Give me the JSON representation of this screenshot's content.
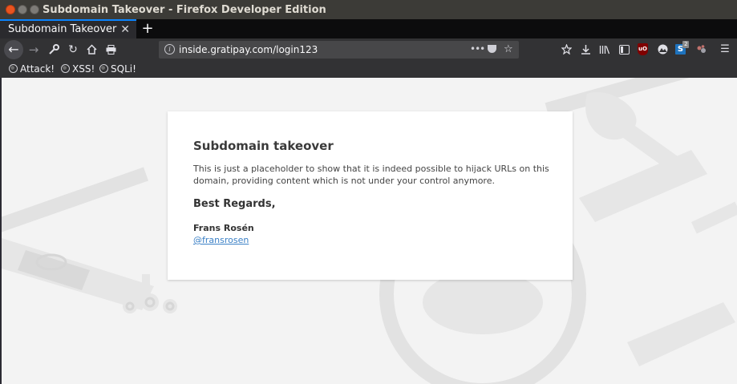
{
  "window": {
    "title": "Subdomain Takeover - Firefox Developer Edition"
  },
  "tabs": [
    {
      "title": "Subdomain Takeover",
      "active": true
    }
  ],
  "toolbar": {
    "url": "inside.gratipay.com/login123",
    "extension_badge": "2",
    "ublock_label": "uO"
  },
  "bookmarks": [
    {
      "label": "Attack!"
    },
    {
      "label": "XSS!"
    },
    {
      "label": "SQLi!"
    }
  ],
  "page": {
    "heading": "Subdomain takeover",
    "body": "This is just a placeholder to show that it is indeed possible to hijack URLs on this domain, providing content which is not under your control anymore.",
    "regards": "Best Regards,",
    "author": "Frans Rosén",
    "handle": "@fransrosen"
  },
  "colors": {
    "accent": "#0a84ff",
    "link": "#3b80c6",
    "page_background": "#f3f3f3"
  }
}
